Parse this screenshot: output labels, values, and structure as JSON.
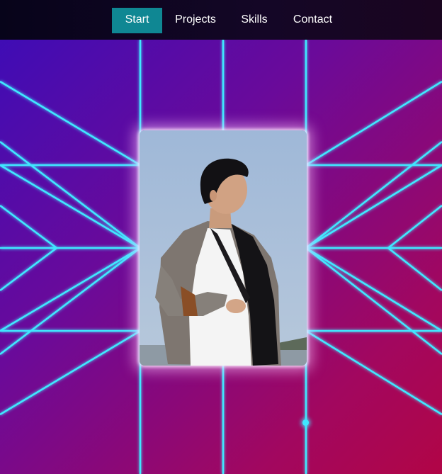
{
  "nav": {
    "items": [
      {
        "label": "Start",
        "active": true
      },
      {
        "label": "Projects",
        "active": false
      },
      {
        "label": "Skills",
        "active": false
      },
      {
        "label": "Contact",
        "active": false
      }
    ]
  },
  "hero": {
    "photo_description": "portrait-photo",
    "background_style": "neon-grid",
    "colors": {
      "gradient_start": "#3a0db8",
      "gradient_end": "#b10546",
      "grid_line": "#3fe8ff",
      "nav_active": "#0f8793",
      "nav_background": "#0b0520"
    }
  }
}
